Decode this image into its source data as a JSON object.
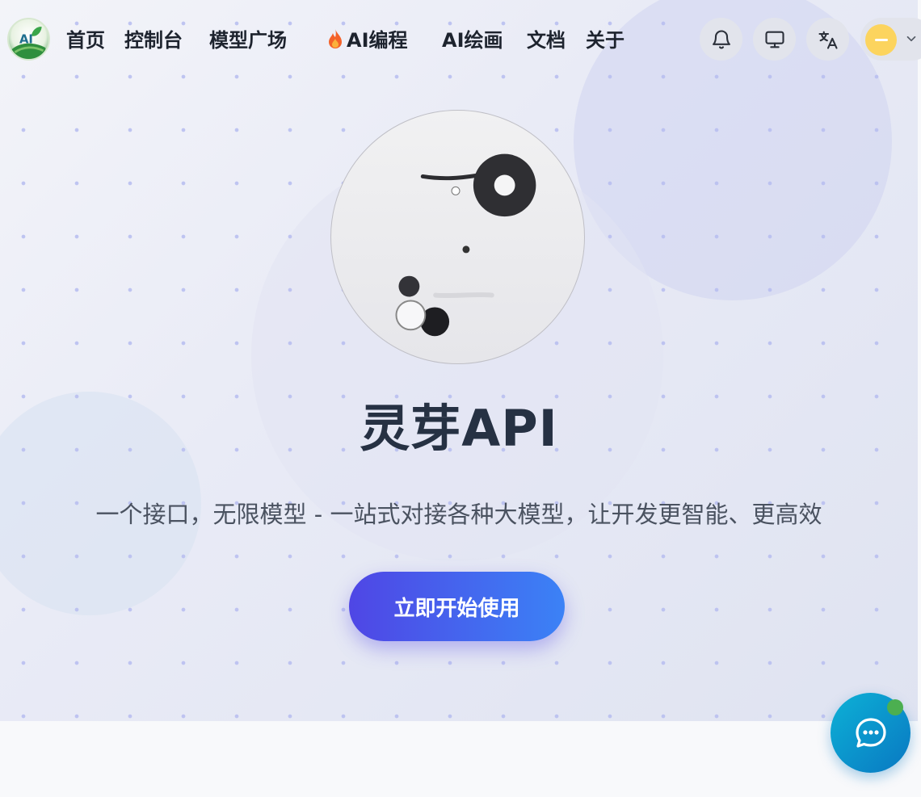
{
  "header": {
    "nav": [
      {
        "label": "首页"
      },
      {
        "label": "控制台"
      },
      {
        "label": "模型广场"
      },
      {
        "label": "AI编程",
        "icon": "fire-icon"
      },
      {
        "label": "AI绘画"
      },
      {
        "label": "文档"
      },
      {
        "label": "关于"
      }
    ],
    "actions": [
      "bell-icon",
      "monitor-icon",
      "translate-icon"
    ],
    "user": {
      "avatar_color": "#fcd45e"
    }
  },
  "hero": {
    "title": "灵芽API",
    "subtitle": "一个接口，无限模型 - 一站式对接各种大模型，让开发更智能、更高效",
    "cta_label": "立即开始使用"
  },
  "colors": {
    "cta_gradient_start": "#4f46e5",
    "cta_gradient_end": "#3b82f6",
    "title": "#263143",
    "chat_fab": "#0a78c2",
    "chat_dot": "#4caf50"
  }
}
